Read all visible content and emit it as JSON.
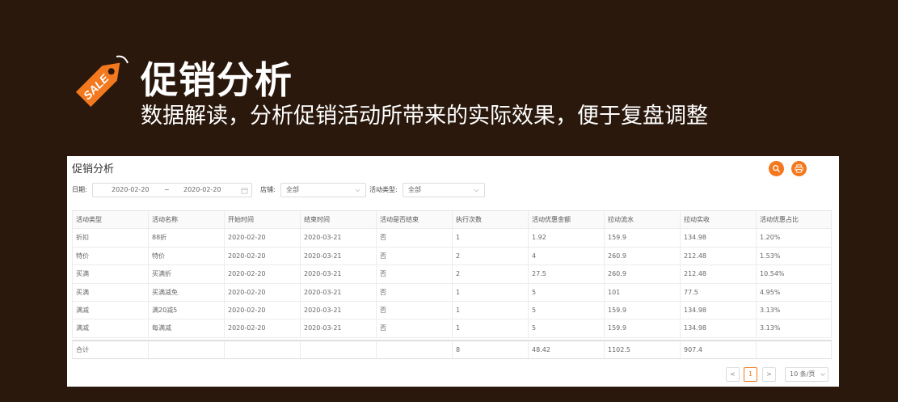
{
  "banner": {
    "title": "促销分析",
    "subtitle": "数据解读，分析促销活动所带来的实际效果，便于复盘调整",
    "tag_text": "SALE"
  },
  "panel": {
    "title": "促销分析",
    "search_icon": "search-icon",
    "print_icon": "print-icon",
    "accent_color": "#f3781e"
  },
  "filters": {
    "date_label": "日期:",
    "date_start": "2020-02-20",
    "date_separator": "~",
    "date_end": "2020-02-20",
    "store_label": "店铺:",
    "store_value": "全部",
    "type_label": "活动类型:",
    "type_value": "全部"
  },
  "table": {
    "headers": [
      "活动类型",
      "活动名称",
      "开始时间",
      "结束时间",
      "活动是否结束",
      "执行次数",
      "活动优惠金额",
      "拉动流水",
      "拉动实收",
      "活动优惠占比"
    ],
    "rows": [
      [
        "折扣",
        "88折",
        "2020-02-20",
        "2020-03-21",
        "否",
        "1",
        "1.92",
        "159.9",
        "134.98",
        "1.20%"
      ],
      [
        "特价",
        "特价",
        "2020-02-20",
        "2020-03-21",
        "否",
        "2",
        "4",
        "260.9",
        "212.48",
        "1.53%"
      ],
      [
        "买满",
        "买满折",
        "2020-02-20",
        "2020-03-21",
        "否",
        "2",
        "27.5",
        "260.9",
        "212.48",
        "10.54%"
      ],
      [
        "买满",
        "买满减免",
        "2020-02-20",
        "2020-03-21",
        "否",
        "1",
        "5",
        "101",
        "77.5",
        "4.95%"
      ],
      [
        "满减",
        "满20减5",
        "2020-02-20",
        "2020-03-21",
        "否",
        "1",
        "5",
        "159.9",
        "134.98",
        "3.13%"
      ],
      [
        "满减",
        "每满减",
        "2020-02-20",
        "2020-03-21",
        "否",
        "1",
        "5",
        "159.9",
        "134.98",
        "3.13%"
      ]
    ],
    "total": [
      "合计",
      "",
      "",
      "",
      "",
      "8",
      "48.42",
      "1102.5",
      "907.4",
      ""
    ]
  },
  "pagination": {
    "prev": "<",
    "current_page": "1",
    "next": ">",
    "page_size": "10 条/页"
  }
}
